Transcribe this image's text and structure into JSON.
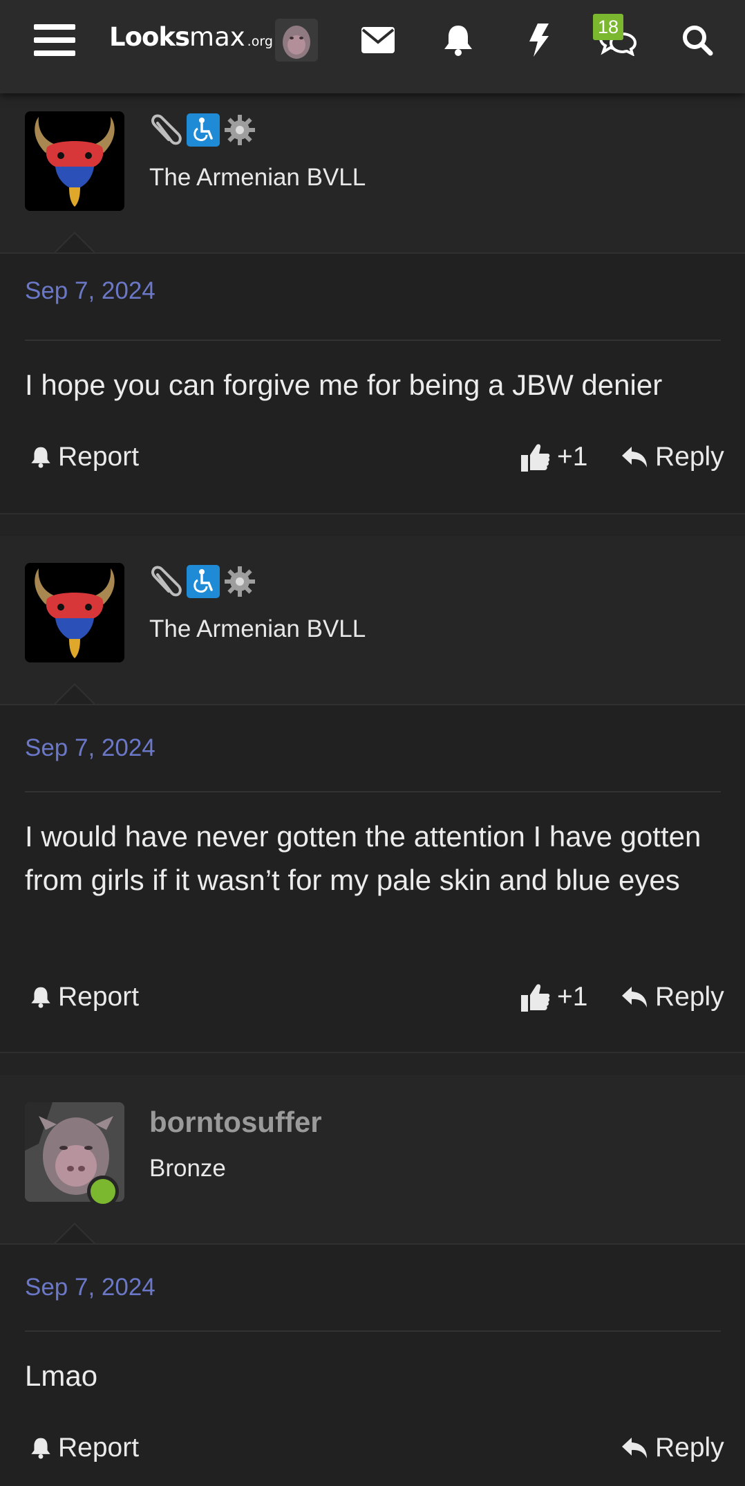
{
  "nav": {
    "logo_looks": "Looks",
    "logo_max": "max",
    "logo_org": ".org",
    "badge_count": "18",
    "icons": [
      "menu-icon",
      "envelope-icon",
      "bell-icon",
      "bolt-icon",
      "chat-icon",
      "search-icon"
    ]
  },
  "posts": [
    {
      "author_title": "The Armenian BVLL",
      "date": "Sep 7, 2024",
      "content": "I hope you can forgive me for being a JBW denier",
      "report_label": "Report",
      "like_count": "+1",
      "reply_label": "Reply"
    },
    {
      "author_title": "The Armenian BVLL",
      "date": "Sep 7, 2024",
      "content": "I would have never gotten the attention I have gotten from girls if it wasn’t for my pale skin and blue eyes",
      "report_label": "Report",
      "like_count": "+1",
      "reply_label": "Reply"
    },
    {
      "username": "borntosuffer",
      "author_title": "Bronze",
      "date": "Sep 7, 2024",
      "content": "Lmao",
      "report_label": "Report",
      "reply_label": "Reply"
    }
  ],
  "colors": {
    "accent_date": "#6b78c8",
    "badge_green": "#7cb82f",
    "online_green": "#7cb82f",
    "wheelchair_blue": "#1f8bd6"
  }
}
